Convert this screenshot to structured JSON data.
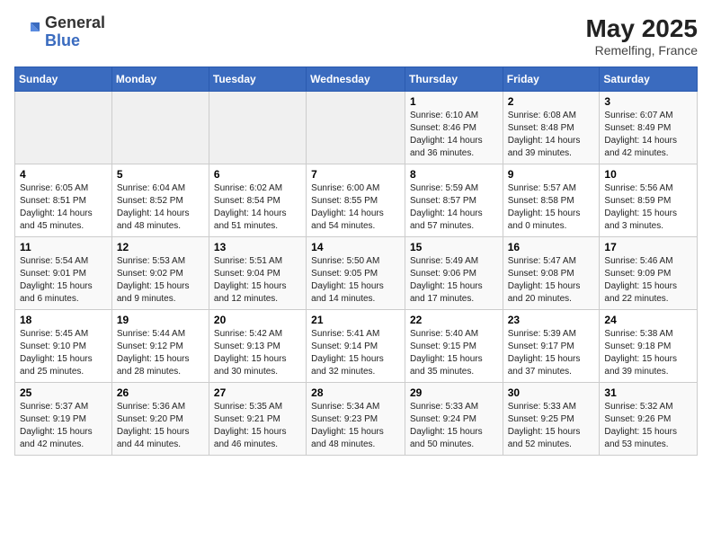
{
  "header": {
    "logo_general": "General",
    "logo_blue": "Blue",
    "month_year": "May 2025",
    "location": "Remelfing, France"
  },
  "weekdays": [
    "Sunday",
    "Monday",
    "Tuesday",
    "Wednesday",
    "Thursday",
    "Friday",
    "Saturday"
  ],
  "weeks": [
    [
      {
        "day": "",
        "info": ""
      },
      {
        "day": "",
        "info": ""
      },
      {
        "day": "",
        "info": ""
      },
      {
        "day": "",
        "info": ""
      },
      {
        "day": "1",
        "info": "Sunrise: 6:10 AM\nSunset: 8:46 PM\nDaylight: 14 hours\nand 36 minutes."
      },
      {
        "day": "2",
        "info": "Sunrise: 6:08 AM\nSunset: 8:48 PM\nDaylight: 14 hours\nand 39 minutes."
      },
      {
        "day": "3",
        "info": "Sunrise: 6:07 AM\nSunset: 8:49 PM\nDaylight: 14 hours\nand 42 minutes."
      }
    ],
    [
      {
        "day": "4",
        "info": "Sunrise: 6:05 AM\nSunset: 8:51 PM\nDaylight: 14 hours\nand 45 minutes."
      },
      {
        "day": "5",
        "info": "Sunrise: 6:04 AM\nSunset: 8:52 PM\nDaylight: 14 hours\nand 48 minutes."
      },
      {
        "day": "6",
        "info": "Sunrise: 6:02 AM\nSunset: 8:54 PM\nDaylight: 14 hours\nand 51 minutes."
      },
      {
        "day": "7",
        "info": "Sunrise: 6:00 AM\nSunset: 8:55 PM\nDaylight: 14 hours\nand 54 minutes."
      },
      {
        "day": "8",
        "info": "Sunrise: 5:59 AM\nSunset: 8:57 PM\nDaylight: 14 hours\nand 57 minutes."
      },
      {
        "day": "9",
        "info": "Sunrise: 5:57 AM\nSunset: 8:58 PM\nDaylight: 15 hours\nand 0 minutes."
      },
      {
        "day": "10",
        "info": "Sunrise: 5:56 AM\nSunset: 8:59 PM\nDaylight: 15 hours\nand 3 minutes."
      }
    ],
    [
      {
        "day": "11",
        "info": "Sunrise: 5:54 AM\nSunset: 9:01 PM\nDaylight: 15 hours\nand 6 minutes."
      },
      {
        "day": "12",
        "info": "Sunrise: 5:53 AM\nSunset: 9:02 PM\nDaylight: 15 hours\nand 9 minutes."
      },
      {
        "day": "13",
        "info": "Sunrise: 5:51 AM\nSunset: 9:04 PM\nDaylight: 15 hours\nand 12 minutes."
      },
      {
        "day": "14",
        "info": "Sunrise: 5:50 AM\nSunset: 9:05 PM\nDaylight: 15 hours\nand 14 minutes."
      },
      {
        "day": "15",
        "info": "Sunrise: 5:49 AM\nSunset: 9:06 PM\nDaylight: 15 hours\nand 17 minutes."
      },
      {
        "day": "16",
        "info": "Sunrise: 5:47 AM\nSunset: 9:08 PM\nDaylight: 15 hours\nand 20 minutes."
      },
      {
        "day": "17",
        "info": "Sunrise: 5:46 AM\nSunset: 9:09 PM\nDaylight: 15 hours\nand 22 minutes."
      }
    ],
    [
      {
        "day": "18",
        "info": "Sunrise: 5:45 AM\nSunset: 9:10 PM\nDaylight: 15 hours\nand 25 minutes."
      },
      {
        "day": "19",
        "info": "Sunrise: 5:44 AM\nSunset: 9:12 PM\nDaylight: 15 hours\nand 28 minutes."
      },
      {
        "day": "20",
        "info": "Sunrise: 5:42 AM\nSunset: 9:13 PM\nDaylight: 15 hours\nand 30 minutes."
      },
      {
        "day": "21",
        "info": "Sunrise: 5:41 AM\nSunset: 9:14 PM\nDaylight: 15 hours\nand 32 minutes."
      },
      {
        "day": "22",
        "info": "Sunrise: 5:40 AM\nSunset: 9:15 PM\nDaylight: 15 hours\nand 35 minutes."
      },
      {
        "day": "23",
        "info": "Sunrise: 5:39 AM\nSunset: 9:17 PM\nDaylight: 15 hours\nand 37 minutes."
      },
      {
        "day": "24",
        "info": "Sunrise: 5:38 AM\nSunset: 9:18 PM\nDaylight: 15 hours\nand 39 minutes."
      }
    ],
    [
      {
        "day": "25",
        "info": "Sunrise: 5:37 AM\nSunset: 9:19 PM\nDaylight: 15 hours\nand 42 minutes."
      },
      {
        "day": "26",
        "info": "Sunrise: 5:36 AM\nSunset: 9:20 PM\nDaylight: 15 hours\nand 44 minutes."
      },
      {
        "day": "27",
        "info": "Sunrise: 5:35 AM\nSunset: 9:21 PM\nDaylight: 15 hours\nand 46 minutes."
      },
      {
        "day": "28",
        "info": "Sunrise: 5:34 AM\nSunset: 9:23 PM\nDaylight: 15 hours\nand 48 minutes."
      },
      {
        "day": "29",
        "info": "Sunrise: 5:33 AM\nSunset: 9:24 PM\nDaylight: 15 hours\nand 50 minutes."
      },
      {
        "day": "30",
        "info": "Sunrise: 5:33 AM\nSunset: 9:25 PM\nDaylight: 15 hours\nand 52 minutes."
      },
      {
        "day": "31",
        "info": "Sunrise: 5:32 AM\nSunset: 9:26 PM\nDaylight: 15 hours\nand 53 minutes."
      }
    ]
  ]
}
